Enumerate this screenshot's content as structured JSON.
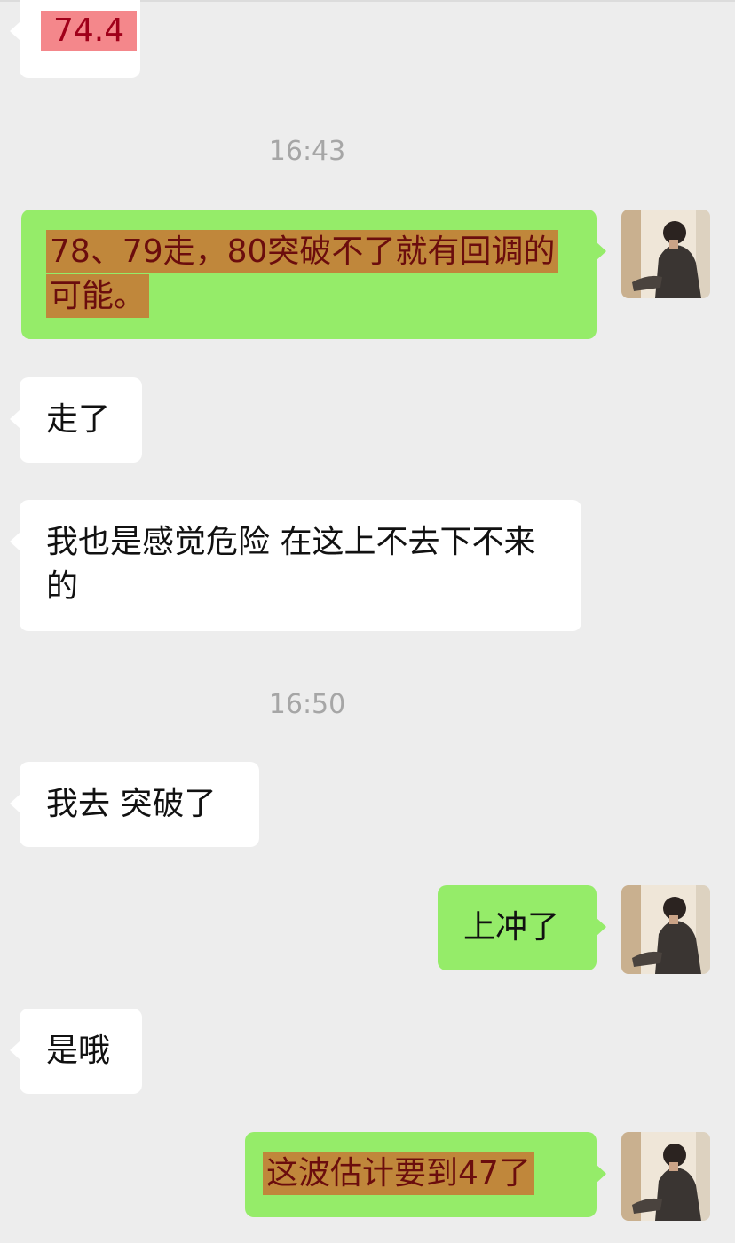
{
  "messages": [
    {
      "type": "in",
      "text": "74.4",
      "highlight": "red"
    },
    {
      "type": "timestamp",
      "text": "16:43"
    },
    {
      "type": "out",
      "text": "78、79走，80突破不了就有回调的可能。",
      "highlight": "orange"
    },
    {
      "type": "in",
      "text": "走了"
    },
    {
      "type": "in",
      "text": "我也是感觉危险 在这上不去下不来的"
    },
    {
      "type": "timestamp",
      "text": "16:50"
    },
    {
      "type": "in",
      "text": "我去 突破了"
    },
    {
      "type": "out",
      "text": "上冲了"
    },
    {
      "type": "in",
      "text": "是哦"
    },
    {
      "type": "out",
      "text": "这波估计要到47了",
      "highlight": "orange"
    }
  ],
  "colors": {
    "background": "#ededed",
    "incoming_bubble": "#ffffff",
    "outgoing_bubble": "#95ec69",
    "timestamp_text": "#a6a6a6",
    "highlight_red": "#f4878b",
    "highlight_orange": "#c0873b"
  },
  "avatar_icon": "user-avatar-photo"
}
